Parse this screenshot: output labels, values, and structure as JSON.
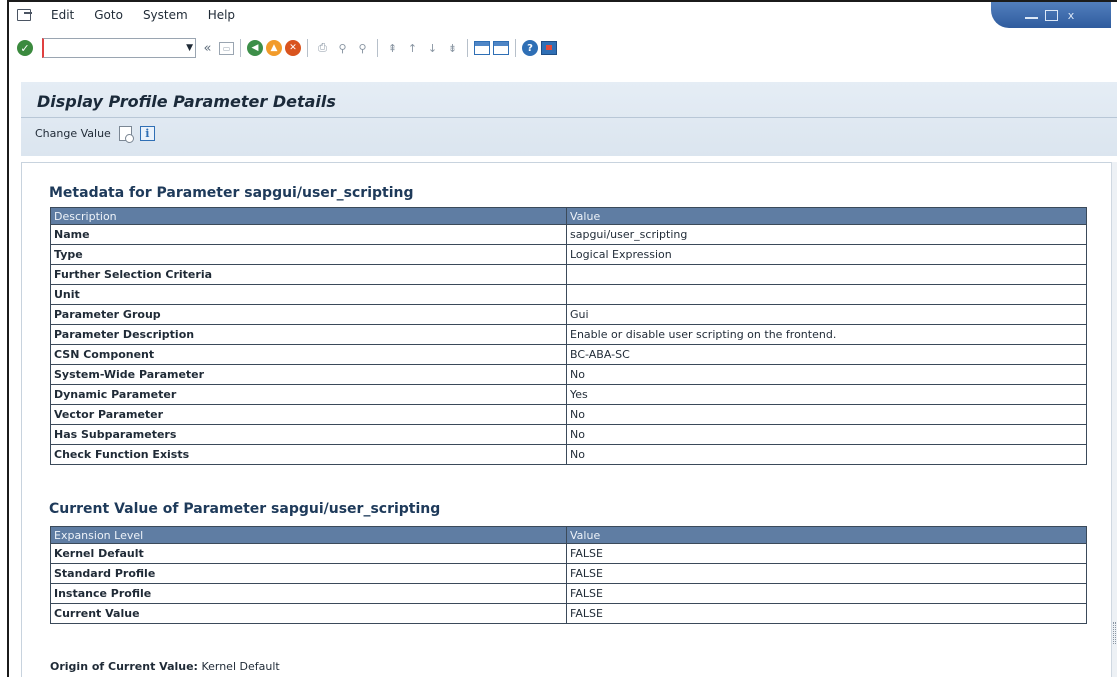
{
  "menu": {
    "items": [
      {
        "label": "Edit",
        "accel": "E"
      },
      {
        "label": "Goto",
        "accel": "G"
      },
      {
        "label": "System",
        "accel": ""
      },
      {
        "label": "Help",
        "accel": "H"
      }
    ]
  },
  "toolbar": {
    "command_value": "",
    "nav_back_glyph": "«"
  },
  "page": {
    "title": "Display Profile Parameter Details",
    "change_value_label": "Change Value"
  },
  "metadata": {
    "section_title": "Metadata for Parameter sapgui/user_scripting",
    "col_description": "Description",
    "col_value": "Value",
    "rows": [
      {
        "k": "Name",
        "v": "sapgui/user_scripting"
      },
      {
        "k": "Type",
        "v": "Logical Expression"
      },
      {
        "k": "Further Selection Criteria",
        "v": ""
      },
      {
        "k": "Unit",
        "v": ""
      },
      {
        "k": "Parameter Group",
        "v": "Gui"
      },
      {
        "k": "Parameter Description",
        "v": "Enable or disable user scripting on the frontend."
      },
      {
        "k": "CSN Component",
        "v": "BC-ABA-SC"
      },
      {
        "k": "System-Wide Parameter",
        "v": "No"
      },
      {
        "k": "Dynamic Parameter",
        "v": "Yes"
      },
      {
        "k": "Vector Parameter",
        "v": "No"
      },
      {
        "k": "Has Subparameters",
        "v": "No"
      },
      {
        "k": "Check Function Exists",
        "v": "No"
      }
    ]
  },
  "current": {
    "section_title": "Current Value of Parameter sapgui/user_scripting",
    "col_level": "Expansion Level",
    "col_value": "Value",
    "rows": [
      {
        "k": "Kernel Default",
        "v": "FALSE"
      },
      {
        "k": "Standard Profile",
        "v": "FALSE"
      },
      {
        "k": "Instance Profile",
        "v": "FALSE"
      },
      {
        "k": "Current Value",
        "v": "FALSE"
      }
    ]
  },
  "origin": {
    "label": "Origin of Current Value:",
    "value": "Kernel Default"
  },
  "colors": {
    "table_header": "#5f7da3",
    "title_panel": "#e5edf5",
    "section_title": "#1e3a5a"
  }
}
